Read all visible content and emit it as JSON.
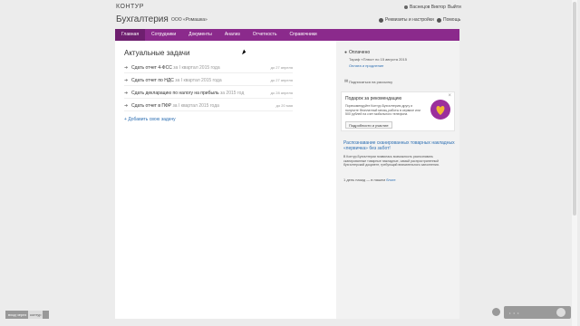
{
  "header": {
    "logo": "КОНТУР",
    "user": "Васнецов Виктор",
    "logout": "Выйти",
    "app_title": "Бухгалтерия",
    "org": "ООО «Ромашка»",
    "settings": "Реквизиты и настройки",
    "help": "Помощь"
  },
  "nav": {
    "items": [
      "Главная",
      "Сотрудники",
      "Документы",
      "Анализ",
      "Отчетность",
      "Справочники"
    ],
    "active_index": 0
  },
  "main": {
    "title": "Актуальные задачи",
    "tasks": [
      {
        "title": "Сдать отчет 4-ФСС",
        "period": "за I квартал 2015 года",
        "due": "до 27 апреля"
      },
      {
        "title": "Сдать отчет по НДС",
        "period": "за I квартал 2015 года",
        "due": "до 27 апреля"
      },
      {
        "title": "Сдать декларацию по налогу на прибыль",
        "period": "за 2015 год",
        "due": "до 28 апреля"
      },
      {
        "title": "Сдать отчет в ПФР",
        "period": "за I квартал 2015 года",
        "due": "до 20 мая"
      }
    ],
    "add_task": "Добавить свою задачу"
  },
  "side": {
    "paid_label": "Оплачено",
    "tariff": "Тариф «Плюс» по 15 августа 2015",
    "payment_link": "Оплата и продление",
    "subscribe": "Подписаться на рассылку",
    "promo": {
      "title": "Подарок за рекомендацию",
      "text": "Порекомендуйте Контур.Бухгалтерию другу и получите бесплатный месяц работы в сервисе или 500 рублей на счет мобильного телефона",
      "button": "Подробности и участие"
    },
    "article": {
      "title": "Распознавание сканированных товарных накладных «первичка» без забот!",
      "text": "В Контур.Бухгалтерии появилась возможность распознавать сканированные товарные накладные, самый распространенный бухгалтерский документ, требующий внимательного заполнения.",
      "meta": "1 день назад — в нашем",
      "meta_link": "блоге"
    }
  },
  "bottom": {
    "badge": "вход через",
    "badge_logo": "контур"
  },
  "colors": {
    "accent": "#8b2a8c",
    "link": "#2d6fb3"
  }
}
